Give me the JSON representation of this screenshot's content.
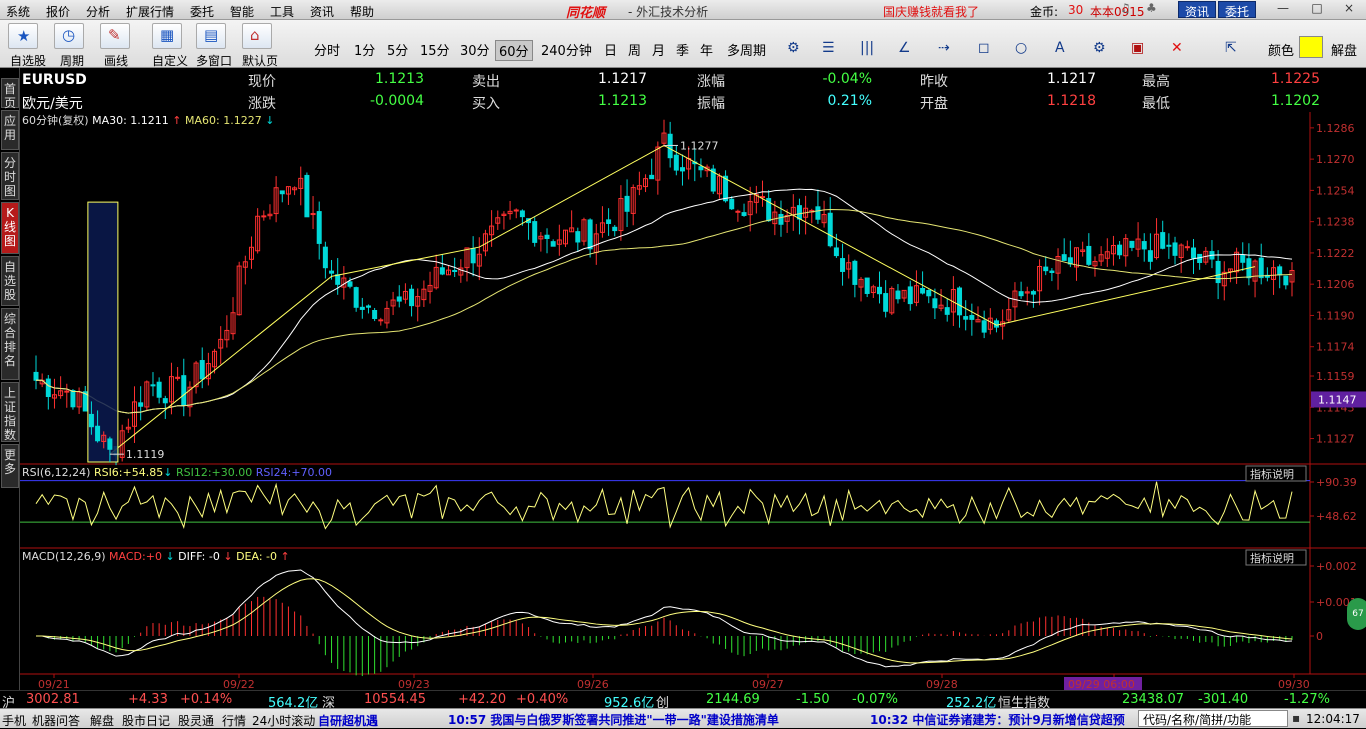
{
  "menu": [
    "系统",
    "报价",
    "分析",
    "扩展行情",
    "委托",
    "智能",
    "工具",
    "资讯",
    "帮助"
  ],
  "app_logo": "同花顺",
  "window_title": "- 外汇技术分析",
  "promo": "国庆赚钱就看我了",
  "coin_label": "金币:",
  "coin_value": "30",
  "version": "本本0915",
  "btn_info": "资讯",
  "btn_trade": "委托",
  "win_ctrl": [
    "—",
    "□",
    "×"
  ],
  "toolbar": {
    "labels": [
      "自选股",
      "周期",
      "画线",
      "自定义",
      "多窗口",
      "默认页"
    ],
    "periods": [
      "分时",
      "1分",
      "5分",
      "15分",
      "30分",
      "60分",
      "240分钟",
      "日",
      "周",
      "月",
      "季",
      "年",
      "多周期"
    ],
    "selected_period": "60分",
    "draw_tools": [
      "☰",
      "|||",
      "∠",
      "⇢",
      "◻",
      "○",
      "A",
      "⚙",
      "▣",
      "✕",
      "⇱"
    ],
    "color_label": "颜色",
    "unlock_label": "解盘"
  },
  "sidetabs": [
    {
      "label": "首页",
      "active": false
    },
    {
      "label": "应用",
      "active": false
    },
    {
      "label": "分时图",
      "active": false
    },
    {
      "label": "K线图",
      "active": true
    },
    {
      "label": "自选股",
      "active": false
    },
    {
      "label": "综合排名",
      "active": false
    },
    {
      "label": "上证指数",
      "active": false
    },
    {
      "label": "更多",
      "active": false
    }
  ],
  "quote": {
    "symbol": "EURUSD",
    "name": "欧元/美元",
    "rows": [
      [
        {
          "l": "现价",
          "v": "1.1213",
          "c": "#44ff44"
        },
        {
          "l": "卖出",
          "v": "1.1217",
          "c": "#ffffff"
        },
        {
          "l": "涨幅",
          "v": "-0.04%",
          "c": "#44ff44"
        },
        {
          "l": "昨收",
          "v": "1.1217",
          "c": "#ffffff"
        },
        {
          "l": "最高",
          "v": "1.1225",
          "c": "#ff4040"
        }
      ],
      [
        {
          "l": "涨跌",
          "v": "-0.0004",
          "c": "#44ff44"
        },
        {
          "l": "买入",
          "v": "1.1213",
          "c": "#44ff44"
        },
        {
          "l": "振幅",
          "v": "0.21%",
          "c": "#44ffff"
        },
        {
          "l": "开盘",
          "v": "1.1218",
          "c": "#ff4040"
        },
        {
          "l": "最低",
          "v": "1.1202",
          "c": "#44ff44"
        }
      ]
    ]
  },
  "colors": {
    "up": "#ff3030",
    "down": "#00d8d8",
    "ma30": "#ffffff",
    "ma60": "#e6e673",
    "rsi6": "#ffff80",
    "rsi_upper": "#3c3cff",
    "rsi_lower": "#40c040",
    "macd_up": "#ff3030",
    "macd_down": "#30e030",
    "diff": "#ffffff",
    "dea": "#ffff80",
    "axis": "#b01010"
  },
  "chart_data": {
    "type": "candlestick",
    "main": {
      "title": "60分钟(复权)",
      "ma30_label": "MA30:",
      "ma30_value": "1.1211",
      "ma30_dir": "↑",
      "ma60_label": "MA60:",
      "ma60_value": "1.1227",
      "ma60_dir": "↓",
      "ylim": [
        1.1115,
        1.1289
      ],
      "yticks": [
        "1.1286",
        "1.1270",
        "1.1254",
        "1.1238",
        "1.1222",
        "1.1206",
        "1.1190",
        "1.1174",
        "1.1159",
        "1.1143",
        "1.1127"
      ],
      "current_price": "1.1147",
      "annotations": [
        {
          "label": "1.1277",
          "price": 1.1277
        },
        {
          "label": "1.1119",
          "price": 1.1119
        }
      ],
      "xlabels": [
        "09/21",
        "09/22",
        "09/23",
        "09/26",
        "09/27",
        "09/28",
        "09/29 06:00",
        "09/30"
      ],
      "highlighted_xlabel": "09/29 06:00",
      "anchors": [
        1.1157,
        1.115,
        1.1119,
        1.1155,
        1.115,
        1.1175,
        1.124,
        1.1262,
        1.121,
        1.1195,
        1.1195,
        1.1212,
        1.1225,
        1.124,
        1.123,
        1.1232,
        1.1244,
        1.1277,
        1.1262,
        1.125,
        1.1243,
        1.1248,
        1.1215,
        1.12,
        1.1198,
        1.1197,
        1.1185,
        1.1207,
        1.1217,
        1.1218,
        1.1225,
        1.1222,
        1.1214,
        1.1215,
        1.1213
      ]
    },
    "rsi": {
      "label": "RSI(6,12,24)",
      "rsi6_label": "RSI6:",
      "rsi6_value": "+54.85",
      "rsi6_dir": "↓",
      "rsi12_label": "RSI12:",
      "rsi12_value": "+30.00",
      "rsi24_label": "RSI24:",
      "rsi24_value": "+70.00",
      "yticks": [
        "+90.39",
        "+48.62"
      ],
      "ylim": [
        0,
        100
      ]
    },
    "macd": {
      "label": "MACD(12,26,9)",
      "macd_label": "MACD:",
      "macd_value": "+0",
      "diff_label": "DIFF:",
      "diff_value": "-0",
      "dea_label": "DEA:",
      "dea_value": "-0",
      "yticks": [
        "+0.002",
        "+0.001",
        "0"
      ]
    },
    "indicator_btn": "指标说明"
  },
  "status": {
    "items": [
      {
        "t": "沪",
        "c": "#ddd"
      },
      {
        "t": "3002.81",
        "c": "#ff5050"
      },
      {
        "t": "+4.33",
        "c": "#ff5050"
      },
      {
        "t": "+0.14%",
        "c": "#ff5050"
      },
      {
        "t": "564.2亿",
        "c": "#44ffff"
      },
      {
        "t": "深",
        "c": "#ddd"
      },
      {
        "t": "10554.45",
        "c": "#ff5050"
      },
      {
        "t": "+42.20",
        "c": "#ff5050"
      },
      {
        "t": "+0.40%",
        "c": "#ff5050"
      },
      {
        "t": "952.6亿",
        "c": "#44ffff"
      },
      {
        "t": "创",
        "c": "#ddd"
      },
      {
        "t": "2144.69",
        "c": "#44ff44"
      },
      {
        "t": "-1.50",
        "c": "#44ff44"
      },
      {
        "t": "-0.07%",
        "c": "#44ff44"
      },
      {
        "t": "252.2亿",
        "c": "#44ffff"
      },
      {
        "t": "恒生指数",
        "c": "#ddd"
      },
      {
        "t": "23438.07",
        "c": "#44ff44"
      },
      {
        "t": "-301.40",
        "c": "#44ff44"
      },
      {
        "t": "-1.27%",
        "c": "#44ff44"
      }
    ]
  },
  "bottom": {
    "tabs": [
      "手机",
      "机器问答",
      "解盘",
      "股市日记",
      "股灵通",
      "行情",
      "24小时滚动",
      "自研超机遇"
    ],
    "news1": "10:57 我国与白俄罗斯签署共同推进\"一带一路\"建设措施清单",
    "news2": "10:32 中信证券诸建芳：预计9月新增信贷超预",
    "code_input": "代码/名称/简拼/功能",
    "time": "12:04:17"
  },
  "badge": "67"
}
